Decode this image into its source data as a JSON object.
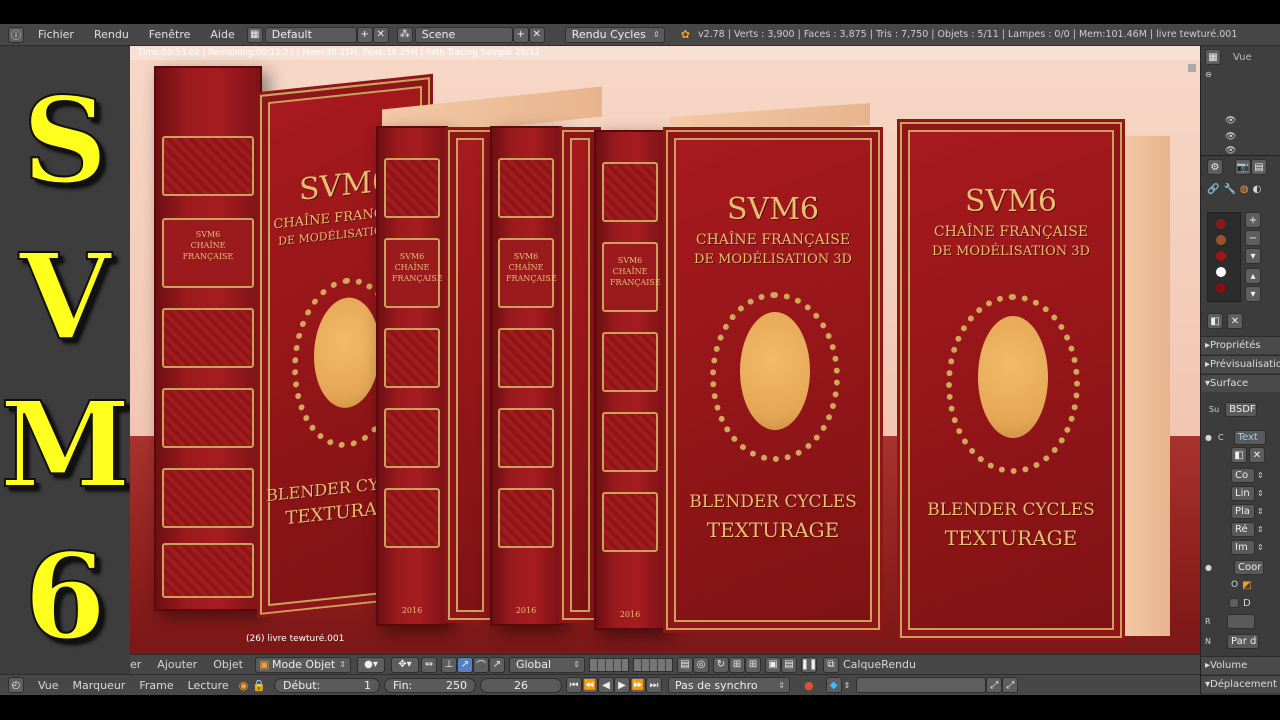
{
  "title_panel": {
    "letters": [
      "S",
      "V",
      "M",
      "6"
    ]
  },
  "info_header": {
    "menus": [
      "Fichier",
      "Rendu",
      "Fenêtre",
      "Aide"
    ],
    "layout": "Default",
    "scene": "Scene",
    "engine": "Rendu Cycles",
    "stats": "v2.78 | Verts : 3,900 | Faces : 3,875 | Tris : 7,750 | Objets : 5/11 | Lampes : 0/0 | Mem:101.46M | livre tewturé.001"
  },
  "viewport": {
    "render_status": "Time:00:53.02 | Remaining:00:12.23 | Mem:36.25M, Peak:36.25M | Path Tracing Sample 26/32",
    "object_label": "(26) livre tewturé.001",
    "books": {
      "cover_title": "SVM6",
      "cover_subtitle_1": "CHAÎNE FRANÇAISE",
      "cover_subtitle_2": "DE MODÉLISATION 3D",
      "cover_footer_1": "BLENDER CYCLES",
      "cover_footer_2": "TEXTURAGE",
      "spine_label_1": "SVM6",
      "spine_label_2": "CHAÎNE",
      "spine_label_3": "FRANÇAISE",
      "spine_year": "2016"
    }
  },
  "viewport_header": {
    "menus": [
      "er",
      "Ajouter",
      "Objet"
    ],
    "mode": "Mode Objet",
    "orientation": "Global",
    "layer": "CalqueRendu"
  },
  "timeline_header": {
    "menus": [
      "Vue",
      "Marqueur",
      "Frame",
      "Lecture"
    ],
    "start_label": "Début:",
    "start_value": "1",
    "end_label": "Fin:",
    "end_value": "250",
    "current_frame": "26",
    "sync": "Pas de synchro"
  },
  "properties": {
    "view_label": "Vue",
    "sections": [
      "Propriétés",
      "Prévisualisation",
      "Surface"
    ],
    "surface_label": "Su",
    "surface_value": "BSDF",
    "texture_btn": "Text",
    "rows": [
      "Co",
      "Lin",
      "Pla",
      "Ré",
      "Im"
    ],
    "coord_btn": "Coor",
    "o_label": "O",
    "d_label": "D",
    "r_label": "R",
    "n_label": "N",
    "n_value": "Par d",
    "bottom_sections": [
      "Volume",
      "Déplacement"
    ],
    "swatch_colors": [
      "#8a1a1a",
      "#a0522d",
      "#a01515",
      "#ffffff",
      "#8b0d12"
    ]
  }
}
